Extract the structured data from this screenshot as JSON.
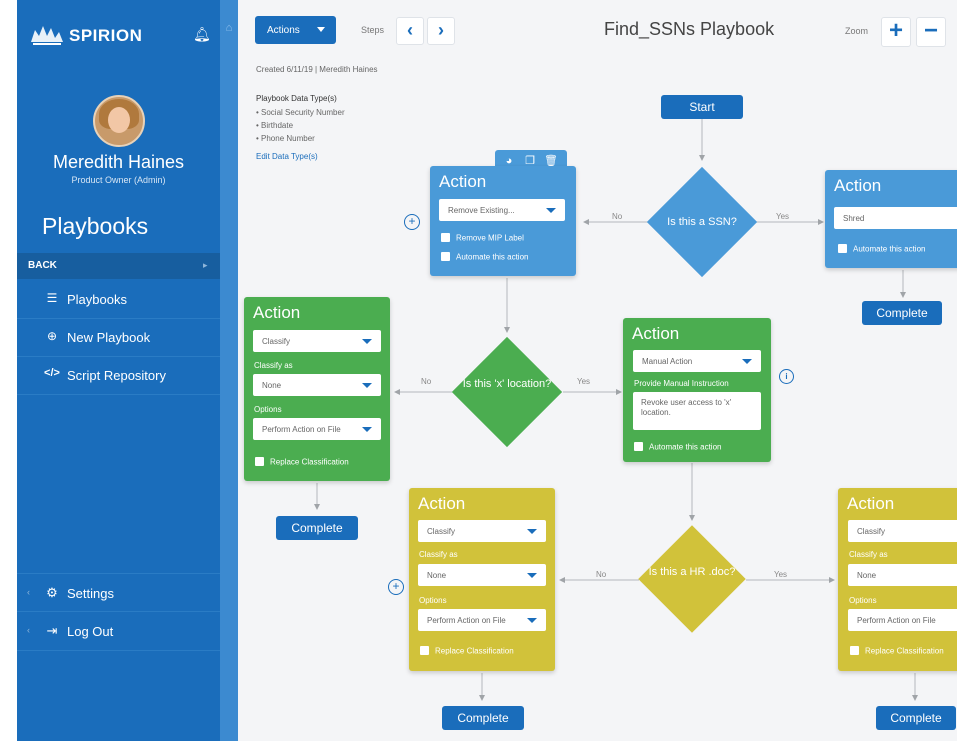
{
  "sidebar": {
    "brand": "SPIRION",
    "user_name": "Meredith Haines",
    "user_role": "Product Owner (Admin)",
    "section_title": "Playbooks",
    "back_label": "BACK",
    "nav": [
      {
        "icon": "list-icon",
        "label": "Playbooks"
      },
      {
        "icon": "plus-circle-icon",
        "label": "New Playbook"
      },
      {
        "icon": "code-icon",
        "label": "Script Repository"
      }
    ],
    "settings_label": "Settings",
    "logout_label": "Log Out"
  },
  "toolbar": {
    "actions_label": "Actions",
    "steps_label": "Steps",
    "title": "Find_SSNs Playbook",
    "zoom_label": "Zoom"
  },
  "meta": {
    "created": "Created 6/11/19 | Meredith Haines",
    "data_types_heading": "Playbook Data Type(s)",
    "data_types": [
      "• Social Security Number",
      "• Birthdate",
      "• Phone Number"
    ],
    "edit_link": "Edit Data Type(s)"
  },
  "flow": {
    "start": "Start",
    "diamonds": {
      "ssn": "Is this a SSN?",
      "location": "Is this 'x' location?",
      "hrdoc": "Is this a HR .doc?"
    },
    "labels": {
      "no": "No",
      "yes": "Yes"
    },
    "action_title": "Action",
    "complete": "Complete",
    "action_remove": {
      "select": "Remove Existing...",
      "check1": "Remove MIP Label",
      "check2": "Automate this action"
    },
    "action_shred": {
      "select": "Shred",
      "check": "Automate this action"
    },
    "action_green_left": {
      "select1": "Classify",
      "label_classify_as": "Classify as",
      "select2": "None",
      "label_options": "Options",
      "select3": "Perform Action on File",
      "check": "Replace Classification"
    },
    "action_manual": {
      "select": "Manual Action",
      "label_instruction": "Provide Manual Instruction",
      "instruction": "Revoke user access to 'x' location.",
      "check": "Automate this action"
    },
    "action_gold_left": {
      "select1": "Classify",
      "label_classify_as": "Classify as",
      "select2": "None",
      "label_options": "Options",
      "select3": "Perform Action on File",
      "check": "Replace Classification"
    },
    "action_gold_right": {
      "select1": "Classify",
      "label_classify_as": "Classify as",
      "select2": "None",
      "label_options": "Options",
      "select3": "Perform Action on File",
      "check": "Replace Classification"
    }
  },
  "colors": {
    "sidebar": "#1a6dbb",
    "blue_node": "#4a9ad8",
    "green_node": "#4bad50",
    "gold_node": "#d1c23a"
  }
}
